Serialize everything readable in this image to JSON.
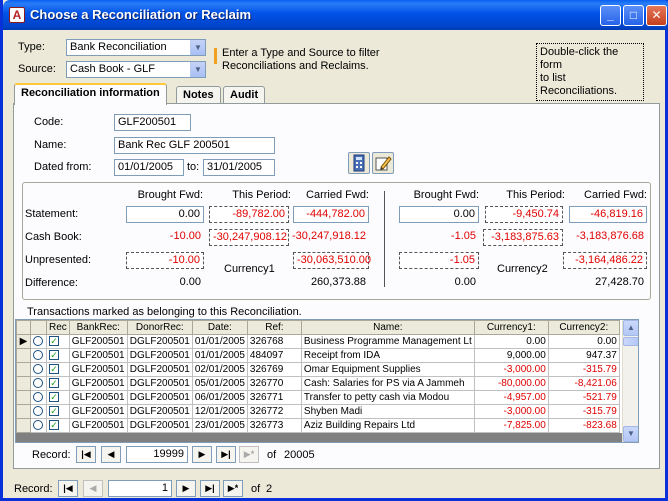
{
  "window": {
    "title": "Choose a Reconciliation or Reclaim",
    "app_icon_letter": "A"
  },
  "filter": {
    "type_label": "Type:",
    "type_value": "Bank Reconciliation",
    "source_label": "Source:",
    "source_value": "Cash Book - GLF",
    "hint": "Enter a Type and Source to filter Reconciliations and Reclaims.",
    "hint_line1": "Enter a Type and Source to filter",
    "hint_line2": "Reconciliations and Reclaims.",
    "dblclick_line1": "Double-click the form",
    "dblclick_line2": "to list Reconciliations."
  },
  "tabs": [
    {
      "label": "Reconciliation information",
      "active": true
    },
    {
      "label": "Notes",
      "active": false
    },
    {
      "label": "Audit",
      "active": false
    }
  ],
  "recon": {
    "code_label": "Code:",
    "code": "GLF200501",
    "name_label": "Name:",
    "name": "Bank Rec GLF 200501",
    "dated_label": "Dated from:",
    "date_from": "01/01/2005",
    "to_label": "to:",
    "date_to": "31/01/2005"
  },
  "summary": {
    "headers": {
      "brought": "Brought Fwd:",
      "period": "This Period:",
      "carried": "Carried Fwd:"
    },
    "row_labels": {
      "statement": "Statement:",
      "cashbook": "Cash Book:",
      "unpresented": "Unpresented:",
      "difference": "Difference:"
    },
    "currency1": {
      "name": "Currency1",
      "statement": {
        "brought": "0.00",
        "period": "-89,782.00",
        "carried": "-444,782.00"
      },
      "cashbook": {
        "brought": "-10.00",
        "period": "-30,247,908.12",
        "carried": "-30,247,918.12"
      },
      "unpresented": {
        "brought": "-10.00",
        "carried": "-30,063,510.00"
      },
      "difference": {
        "brought": "0.00",
        "carried": "260,373.88"
      }
    },
    "currency2": {
      "name": "Currency2",
      "statement": {
        "brought": "0.00",
        "period": "-9,450.74",
        "carried": "-46,819.16"
      },
      "cashbook": {
        "brought": "-1.05",
        "period": "-3,183,875.63",
        "carried": "-3,183,876.68"
      },
      "unpresented": {
        "brought": "-1.05",
        "carried": "-3,164,486.22"
      },
      "difference": {
        "brought": "0.00",
        "carried": "27,428.70"
      }
    }
  },
  "transactions": {
    "caption": "Transactions marked as belonging to this Reconciliation.",
    "columns": [
      "Rec",
      "BankRec:",
      "DonorRec:",
      "Date:",
      "Ref:",
      "Name:",
      "Currency1:",
      "Currency2:"
    ],
    "rows": [
      {
        "current": true,
        "rec": true,
        "bankrec": "GLF200501",
        "donorrec": "DGLF200501",
        "date": "01/01/2005",
        "ref": "326768",
        "name": "Business Programme Management Lt",
        "c1": "0.00",
        "c2": "0.00"
      },
      {
        "current": false,
        "rec": true,
        "bankrec": "GLF200501",
        "donorrec": "DGLF200501",
        "date": "01/01/2005",
        "ref": "484097",
        "name": "Receipt from IDA",
        "c1": "9,000.00",
        "c2": "947.37"
      },
      {
        "current": false,
        "rec": true,
        "bankrec": "GLF200501",
        "donorrec": "DGLF200501",
        "date": "02/01/2005",
        "ref": "326769",
        "name": "Omar Equipment Supplies",
        "c1": "-3,000.00",
        "c2": "-315.79"
      },
      {
        "current": false,
        "rec": true,
        "bankrec": "GLF200501",
        "donorrec": "DGLF200501",
        "date": "05/01/2005",
        "ref": "326770",
        "name": "Cash: Salaries for PS via A Jammeh",
        "c1": "-80,000.00",
        "c2": "-8,421.06"
      },
      {
        "current": false,
        "rec": true,
        "bankrec": "GLF200501",
        "donorrec": "DGLF200501",
        "date": "06/01/2005",
        "ref": "326771",
        "name": "Transfer to petty cash via Modou",
        "c1": "-4,957.00",
        "c2": "-521.79"
      },
      {
        "current": false,
        "rec": true,
        "bankrec": "GLF200501",
        "donorrec": "DGLF200501",
        "date": "12/01/2005",
        "ref": "326772",
        "name": "Shyben Madi",
        "c1": "-3,000.00",
        "c2": "-315.79"
      },
      {
        "current": false,
        "rec": true,
        "bankrec": "GLF200501",
        "donorrec": "DGLF200501",
        "date": "23/01/2005",
        "ref": "326773",
        "name": "Aziz Building Repairs Ltd",
        "c1": "-7,825.00",
        "c2": "-823.68"
      }
    ],
    "nav": {
      "label": "Record:",
      "current": "19999",
      "of_label": "of",
      "total": "20005"
    }
  },
  "form_nav": {
    "label": "Record:",
    "current": "1",
    "of_label": "of",
    "total": "2"
  },
  "colors": {
    "negative": "#e00000",
    "titlebar": "#0052e7",
    "tab_highlight": "#ffc83c"
  }
}
